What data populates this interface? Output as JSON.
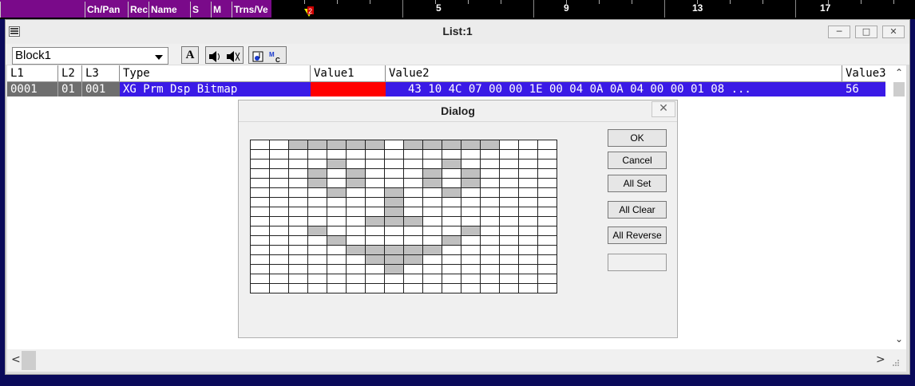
{
  "topbar": {
    "columns": [
      "",
      "Ch/Pan",
      "Rec",
      "Name",
      "S",
      "M",
      "Trns/Ve"
    ],
    "ruler_numbers": [
      "5",
      "9",
      "13",
      "17"
    ],
    "marker_label": "2"
  },
  "window": {
    "title": "List:1",
    "min_label": "─",
    "max_label": "□",
    "close_label": "✕"
  },
  "toolbar": {
    "block_value": "Block1",
    "font_button": "A",
    "speaker_icon": "speaker-icon",
    "speaker_muted_icon": "speaker-muted-icon",
    "note_tool_icon": "note-tool-icon",
    "mc_tool_icon": "mc-tool-icon"
  },
  "list": {
    "headers": {
      "l1": "L1",
      "l2": "L2",
      "l3": "L3",
      "type": "Type",
      "value1": "Value1",
      "value2": "Value2",
      "value3": "Value3"
    },
    "row": {
      "l1": "0001",
      "l2": "01",
      "l3": "001",
      "type": "XG Prm Dsp Bitmap",
      "value1": "",
      "value2": "43 10 4C 07 00 00 1E 00 04 0A 0A 04 00 00 01 08 ...",
      "value3": "56",
      "value1_color": "#ff0000",
      "row_color": "#3a1ae6"
    }
  },
  "dialog": {
    "title": "Dialog",
    "close_label": "✕",
    "buttons": {
      "ok": "OK",
      "cancel": "Cancel",
      "all_set": "All Set",
      "all_clear": "All Clear",
      "all_reverse": "All Reverse"
    },
    "bitmap": [
      "0011111011111000",
      "0000000000000000",
      "0000100000100000",
      "0001010001010000",
      "0001010001010000",
      "0000100100100000",
      "0000000100000000",
      "0000000100000000",
      "0000001110000000",
      "0001000000010000",
      "0000100000100000",
      "0000011111000000",
      "0000001110000000",
      "0000000100000000",
      "0000000000000000",
      "0000000000000000"
    ]
  },
  "scroll": {
    "up": "⌃",
    "down": "⌄",
    "left": "<",
    "right": ">"
  }
}
